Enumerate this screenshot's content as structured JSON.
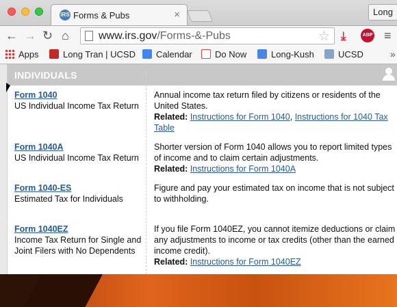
{
  "browser": {
    "tab_title": "Forms & Pubs",
    "tab_close": "×",
    "tab_favicon": "IRS",
    "profile_label": "Long",
    "url_host": "www.irs.gov",
    "url_path": "/Forms-&-Pubs",
    "abp_label": "ABP",
    "nav_back": "←",
    "nav_forward": "→",
    "nav_reload": "↻",
    "nav_home": "⌂",
    "star": "☆",
    "menu": "≡",
    "download": "⤓"
  },
  "bookmarks": {
    "items": [
      {
        "label": "Apps",
        "icon": "apps-icon"
      },
      {
        "label": "Long Tran | UCSD",
        "icon": "lt-icon",
        "color": "#c62828"
      },
      {
        "label": "Calendar",
        "icon": "google-icon",
        "color": "#4285f4"
      },
      {
        "label": "Do Now",
        "icon": "todoist-icon",
        "color": "#e44232"
      },
      {
        "label": "Long-Kush",
        "icon": "docs-icon",
        "color": "#4a86e8"
      },
      {
        "label": "UCSD",
        "icon": "folder-icon",
        "color": "#8aa4c8"
      }
    ],
    "more": "»"
  },
  "table": {
    "heading": "INDIVIDUALS",
    "header_color": "#c8c8c8",
    "link_color": "#2a5a8f",
    "rows": [
      {
        "form": "Form 1040",
        "form_desc": "US Individual Income Tax Return",
        "desc": "Annual income tax return filed by citizens or residents of the United States.",
        "related_label": "Related:",
        "related": [
          "Instructions for Form 1040",
          "Instructions for 1040 Tax Table"
        ],
        "sep": ","
      },
      {
        "form": "Form 1040A",
        "form_desc": "US Individual Income Tax Return",
        "desc": "Shorter version of Form 1040 allows you to report limited types of income and to claim certain adjustments.",
        "related_label": "Related:",
        "related": [
          "Instructions for Form 1040A"
        ]
      },
      {
        "form": "Form 1040-ES",
        "form_desc": "Estimated Tax for Individuals",
        "desc": "Figure and pay your estimated tax on income that is not subject to withholding."
      },
      {
        "form": "Form 1040EZ",
        "form_desc": "Income Tax Return for Single and Joint Filers with No Dependents",
        "desc": "If you file Form 1040EZ, you cannot itemize deductions or claim any adjustments to income or tax credits (other than the earned income credit).",
        "related_label": "Related:",
        "related": [
          "Instructions for Form 1040EZ"
        ]
      }
    ]
  }
}
